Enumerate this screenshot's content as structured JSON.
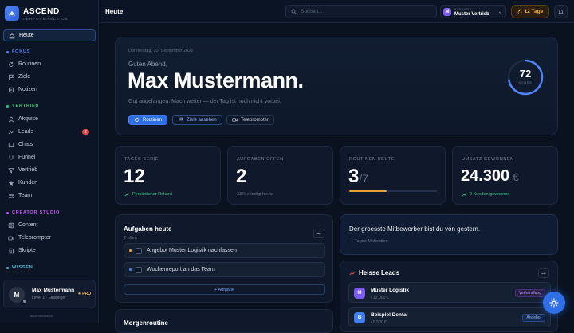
{
  "brand": {
    "name": "ASCEND",
    "tagline": "PERFORMANCE OS"
  },
  "sidebar": {
    "today": "Heute",
    "sections": {
      "fokus": "FOKUS",
      "vertrieb": "VERTRIEB",
      "creator": "CREATOR STUDIO",
      "wissen": "WISSEN"
    },
    "items": {
      "routinen": "Routinen",
      "ziele": "Ziele",
      "notizen": "Notizen",
      "akquise": "Akquise",
      "leads": "Leads",
      "leads_badge": "2",
      "chats": "Chats",
      "funnel": "Funnel",
      "vertrieb": "Vertrieb",
      "kunden": "Kunden",
      "team": "Team",
      "content": "Content",
      "teleprompter": "Teleprompter",
      "skripte": "Skripte"
    },
    "user": {
      "initial": "M",
      "name": "Max Mustermann",
      "level": "Level 1 · Einsteiger",
      "plan": "★ PRO"
    },
    "footer": "ascendfuture.de"
  },
  "topbar": {
    "title": "Heute",
    "search_placeholder": "Suchen...",
    "business": {
      "initial": "M",
      "label": "BUSINESS",
      "name": "Muster Vertrieb"
    },
    "streak": "12 Tage"
  },
  "hero": {
    "date": "Donnerstag, 10. September 2026",
    "greeting": "Guten Abend,",
    "name": "Max Mustermann.",
    "subtitle": "Gut angefangen. Mach weiter — der Tag ist noch nicht vorbei.",
    "buttons": {
      "routinen": "Routinen",
      "ziele": "Ziele ansehen",
      "teleprompter": "Teleprompter"
    },
    "score": {
      "value": "72",
      "label": "SCORE",
      "fraction": 0.72
    }
  },
  "stats": [
    {
      "label": "TAGES-SERIE",
      "value": "12",
      "sub": "Persönlicher Rekord"
    },
    {
      "label": "AUFGABEN OFFEN",
      "value": "2",
      "sub": "33% erledigt heute"
    },
    {
      "label": "ROUTINEN HEUTE",
      "value": "3",
      "suffix": "/7",
      "progress": 0.43
    },
    {
      "label": "UMSATZ GEWONNEN",
      "value": "24.300",
      "suffix": " €",
      "sub": "2 Kunden gewonnen"
    }
  ],
  "tasks": {
    "title": "Aufgaben heute",
    "sub": "2 offen",
    "items": [
      {
        "text": "Angebot Muster Logistik nachfassen",
        "color": "#f0a23a"
      },
      {
        "text": "Wochenreport an das Team",
        "color": "#4f86f7"
      }
    ],
    "add": "+  Aufgabe"
  },
  "next": {
    "title": "Morgenroutine"
  },
  "quote": {
    "text": "Der groesste Mitbewerber bist du von gestern.",
    "source": "— Tages-Motivation"
  },
  "leads": {
    "title": "Heisse Leads",
    "items": [
      {
        "initial": "M",
        "name": "Muster Logistik",
        "value": "• 12.000 €",
        "status": "Verhandlung",
        "color": "#7c5cf0"
      },
      {
        "initial": "B",
        "name": "Beispiel Dental",
        "value": "• 8.500 €",
        "status": "Angebot",
        "color": "#3f7ff0"
      }
    ]
  },
  "colors": {
    "accent": "#2f6fe8",
    "green": "#3cc47c",
    "amber": "#f0b43a",
    "red": "#e04848",
    "purple": "#7c5cf0"
  }
}
